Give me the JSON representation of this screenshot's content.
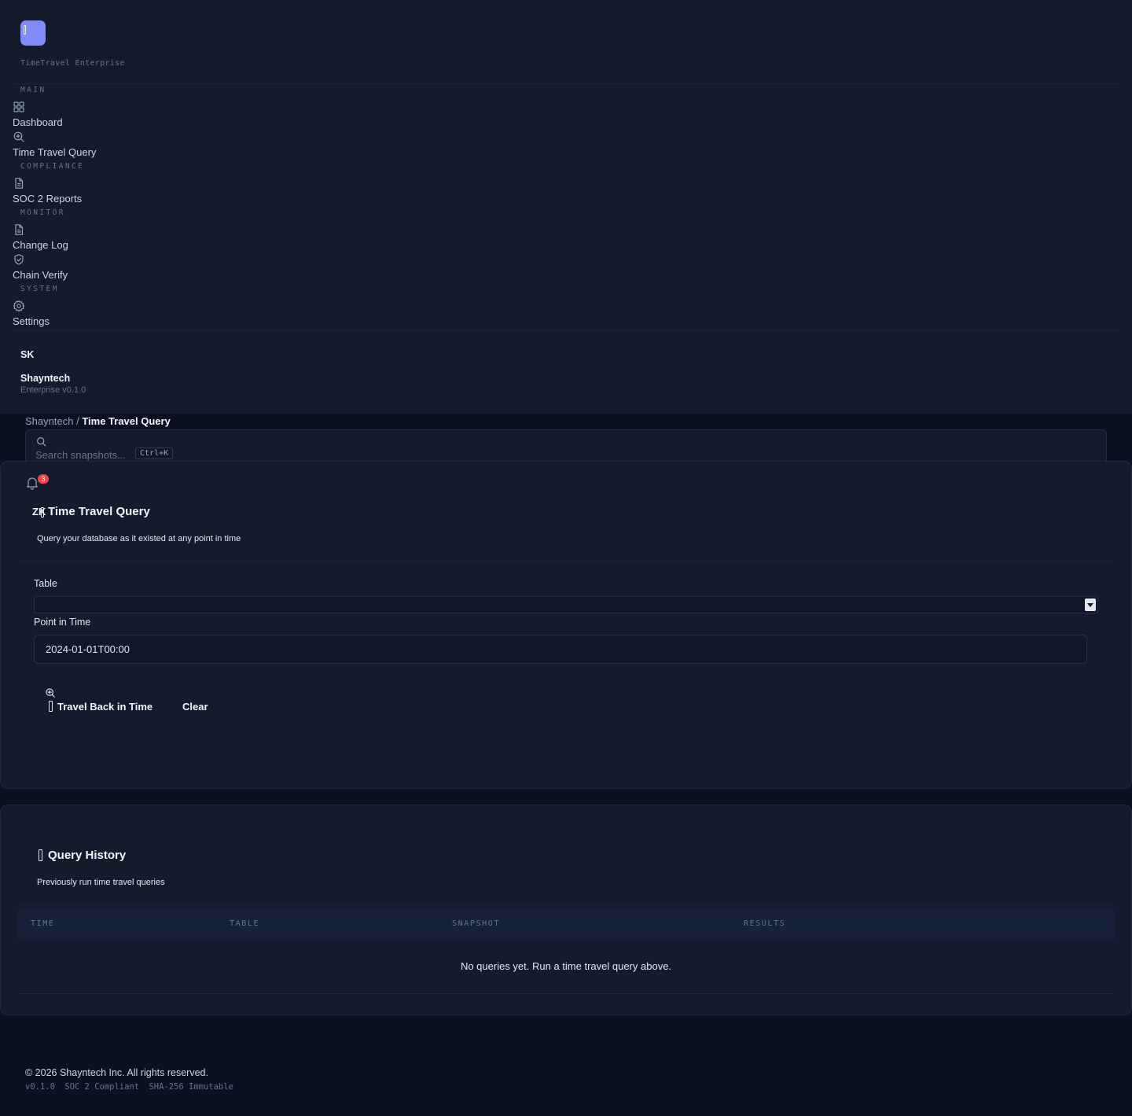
{
  "sidebar": {
    "brand_subtitle": "TimeTravel Enterprise",
    "sections": {
      "main": "MAIN",
      "compliance": "COMPLIANCE",
      "monitor": "MONITOR",
      "system": "SYSTEM"
    },
    "items": {
      "dashboard": "Dashboard",
      "time_travel_query": "Time Travel Query",
      "soc2_reports": "SOC 2 Reports",
      "change_log": "Change Log",
      "chain_verify": "Chain Verify",
      "settings": "Settings"
    },
    "user": {
      "initials": "SK",
      "name": "Shayntech",
      "subtitle": "Enterprise v0.1.0"
    }
  },
  "header": {
    "breadcrumb_root": "Shayntech",
    "breadcrumb_separator": "/",
    "breadcrumb_current": "Time Travel Query",
    "search_placeholder": "Search snapshots...",
    "search_shortcut": "Ctrl+K",
    "notification_count": "3",
    "zk_label": "ZK"
  },
  "query_card": {
    "title": "Time Travel Query",
    "subtitle": "Query your database as it existed at any point in time",
    "table_label": "Table",
    "table_value": "",
    "point_label": "Point in Time",
    "point_value": "2024-01-01T00:00",
    "travel_button": "Travel Back in Time",
    "clear_button": "Clear"
  },
  "history_card": {
    "title": "Query History",
    "subtitle": "Previously run time travel queries",
    "columns": [
      "TIME",
      "TABLE",
      "SNAPSHOT",
      "RESULTS"
    ],
    "empty_message": "No queries yet. Run a time travel query above."
  },
  "footer": {
    "copyright": "© 2026 Shayntech Inc. All rights reserved.",
    "meta": [
      "v0.1.0",
      "SOC 2 Compliant",
      "SHA-256 Immutable"
    ]
  },
  "colors": {
    "accent": "#818cf8",
    "badge": "#ef4444",
    "background": "#0b1120",
    "surface": "#131b2c"
  }
}
